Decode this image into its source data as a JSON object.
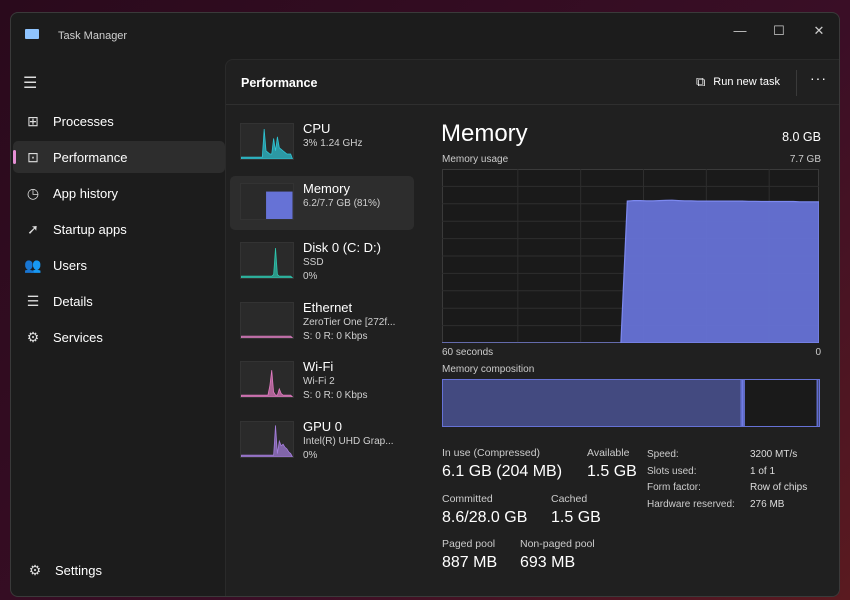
{
  "window": {
    "title": "Task Manager",
    "icon": "task-manager-icon",
    "controls": [
      "minimize",
      "maximize",
      "close"
    ]
  },
  "sidebar": {
    "items": [
      {
        "label": "Processes",
        "icon": "processes-icon",
        "glyph": "⊞"
      },
      {
        "label": "Performance",
        "icon": "performance-icon",
        "glyph": "⊡",
        "active": true
      },
      {
        "label": "App history",
        "icon": "history-icon",
        "glyph": "◷"
      },
      {
        "label": "Startup apps",
        "icon": "startup-icon",
        "glyph": "➚"
      },
      {
        "label": "Users",
        "icon": "users-icon",
        "glyph": "👥"
      },
      {
        "label": "Details",
        "icon": "details-icon",
        "glyph": "☰"
      },
      {
        "label": "Services",
        "icon": "services-icon",
        "glyph": "⚙"
      }
    ],
    "settings": {
      "label": "Settings",
      "icon": "gear-icon"
    }
  },
  "header": {
    "title": "Performance",
    "run_new_task": "Run new task",
    "more": "···"
  },
  "devices": [
    {
      "name": "CPU",
      "lines": [
        "3% 1.24 GHz"
      ],
      "color": "#2ec8d8"
    },
    {
      "name": "Memory",
      "lines": [
        "6.2/7.7 GB (81%)"
      ],
      "color": "#6672d6",
      "active": true
    },
    {
      "name": "Disk 0 (C: D:)",
      "lines": [
        "SSD",
        "0%"
      ],
      "color": "#2ec8b0"
    },
    {
      "name": "Ethernet",
      "lines": [
        "ZeroTier One [272f...",
        "S: 0 R: 0 Kbps"
      ],
      "color": "#d87bbd"
    },
    {
      "name": "Wi-Fi",
      "lines": [
        "Wi-Fi 2",
        "S: 0 R: 0 Kbps"
      ],
      "color": "#e57cc4"
    },
    {
      "name": "GPU 0",
      "lines": [
        "Intel(R) UHD Grap...",
        "0%"
      ],
      "color": "#a77fe0"
    }
  ],
  "memory": {
    "title": "Memory",
    "total": "8.0 GB",
    "usage_label": "Memory usage",
    "usage_max": "7.7 GB",
    "x_left": "60 seconds",
    "x_right": "0",
    "composition_label": "Memory composition",
    "stats": [
      {
        "label": "In use (Compressed)",
        "value": "6.1 GB (204 MB)"
      },
      {
        "label": "Available",
        "value": "1.5 GB"
      },
      {
        "label": "Committed",
        "value": "8.6/28.0 GB"
      },
      {
        "label": "Cached",
        "value": "1.5 GB"
      },
      {
        "label": "Paged pool",
        "value": "887 MB"
      },
      {
        "label": "Non-paged pool",
        "value": "693 MB"
      }
    ],
    "specs": [
      {
        "label": "Speed:",
        "value": "3200 MT/s"
      },
      {
        "label": "Slots used:",
        "value": "1 of 1"
      },
      {
        "label": "Form factor:",
        "value": "Row of chips"
      },
      {
        "label": "Hardware reserved:",
        "value": "276 MB"
      }
    ]
  },
  "chart_data": {
    "type": "area",
    "xlabel": "60 seconds",
    "xlim": [
      60,
      0
    ],
    "ylim": [
      0,
      7.7
    ],
    "grid": true,
    "color": "#6672d6",
    "usage_gb": [
      0,
      0,
      0,
      0,
      0,
      0,
      0,
      0,
      0,
      0,
      0,
      0,
      0,
      0,
      0,
      0,
      0,
      0,
      0,
      0,
      0,
      0,
      0,
      0,
      0,
      0,
      0,
      0,
      0,
      6.28,
      6.3,
      6.3,
      6.29,
      6.29,
      6.3,
      6.31,
      6.32,
      6.3,
      6.29,
      6.29,
      6.28,
      6.28,
      6.28,
      6.28,
      6.28,
      6.28,
      6.28,
      6.28,
      6.27,
      6.27,
      6.26,
      6.26,
      6.26,
      6.26,
      6.26,
      6.26,
      6.25,
      6.25,
      6.25,
      6.25
    ],
    "composition_gb": {
      "in_use": 6.1,
      "modified": 0.05,
      "standby": 1.5,
      "free": 0.05
    }
  }
}
